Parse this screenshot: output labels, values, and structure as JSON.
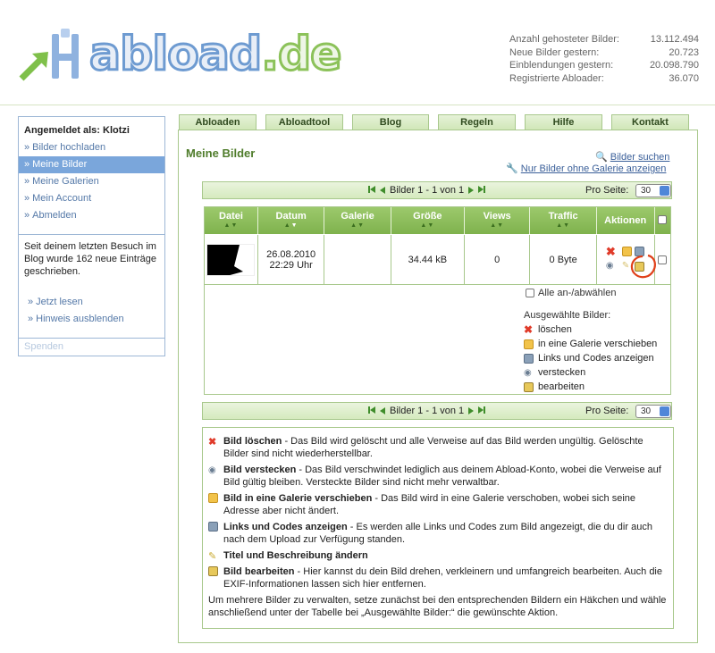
{
  "site": {
    "logo_main": "abload",
    "logo_tld": ".de"
  },
  "stats": [
    {
      "label": "Anzahl gehosteter Bilder:",
      "value": "13.112.494"
    },
    {
      "label": "Neue Bilder gestern:",
      "value": "20.723"
    },
    {
      "label": "Einblendungen gestern:",
      "value": "20.098.790"
    },
    {
      "label": "Registrierte Abloader:",
      "value": "36.070"
    }
  ],
  "sidebar": {
    "heading": "Angemeldet als: Klotzi",
    "items": [
      {
        "label": "Bilder hochladen",
        "active": false
      },
      {
        "label": "Meine Bilder",
        "active": true
      },
      {
        "label": "Meine Galerien",
        "active": false
      },
      {
        "label": "Mein Account",
        "active": false
      },
      {
        "label": "Abmelden",
        "active": false
      }
    ],
    "notice": "Seit deinem letzten Besuch im Blog wurde 162 neue Einträge geschrieben.",
    "links": [
      "» Jetzt lesen",
      "» Hinweis ausblenden"
    ],
    "footer": "Spenden"
  },
  "tabs": [
    "Abloaden",
    "Abloadtool",
    "Blog",
    "Regeln",
    "Hilfe",
    "Kontakt"
  ],
  "page_title": "Meine Bilder",
  "top_links": {
    "search": "Bilder suchen",
    "no_gallery": "Nur Bilder ohne Galerie anzeigen"
  },
  "pager": {
    "text": "Bilder 1 - 1 von 1",
    "per_page_label": "Pro Seite:",
    "per_page_value": "30"
  },
  "table": {
    "headers": [
      "Datei",
      "Datum",
      "Galerie",
      "Größe",
      "Views",
      "Traffic",
      "Aktionen"
    ],
    "rows": [
      {
        "date": "26.08.2010",
        "time": "22:29 Uhr",
        "gallery": "",
        "size": "34.44 kB",
        "views": "0",
        "traffic": "0 Byte"
      }
    ]
  },
  "select_all": "Alle an-/abwählen",
  "selected_heading": "Ausgewählte Bilder:",
  "selected_actions": [
    "löschen",
    "in eine Galerie verschieben",
    "Links und Codes anzeigen",
    "verstecken",
    "bearbeiten"
  ],
  "help": [
    {
      "icon": "delete-icon",
      "title": "Bild löschen",
      "text": " - Das Bild wird gelöscht und alle Verweise auf das Bild werden ungültig. Gelöschte Bilder sind nicht wiederherstellbar."
    },
    {
      "icon": "hide-icon",
      "title": "Bild verstecken",
      "text": " - Das Bild verschwindet lediglich aus deinem Abload-Konto, wobei die Verweise auf Bild gültig bleiben. Versteckte Bilder sind nicht mehr verwaltbar."
    },
    {
      "icon": "move-to-gallery-icon",
      "title": "Bild in eine Galerie verschieben",
      "text": " - Das Bild wird in eine Galerie verschoben, wobei sich seine Adresse aber nicht ändert."
    },
    {
      "icon": "links-codes-icon",
      "title": "Links und Codes anzeigen",
      "text": " - Es werden alle Links und Codes zum Bild angezeigt, die du dir auch nach dem Upload zur Verfügung standen."
    },
    {
      "icon": "edit-title-icon",
      "title": "Titel und Beschreibung ändern",
      "text": ""
    },
    {
      "icon": "edit-image-icon",
      "title": "Bild bearbeiten",
      "text": " - Hier kannst du dein Bild drehen, verkleinern und umfangreich bearbeiten. Auch die EXIF-Informationen lassen sich hier entfernen."
    }
  ],
  "help_footer": "Um mehrere Bilder zu verwalten, setze zunächst bei den entsprechenden Bildern ein Häkchen und wähle anschließend unter der Tabelle bei „Ausgewählte Bilder:“ die gewünschte Aktion.",
  "colors": {
    "accent_green": "#4f7c2b",
    "header_green": "#8cbf5a",
    "link_blue": "#3a5f99",
    "sidebar_active": "#7aa6db",
    "annotation_circle": "#e0401a"
  }
}
